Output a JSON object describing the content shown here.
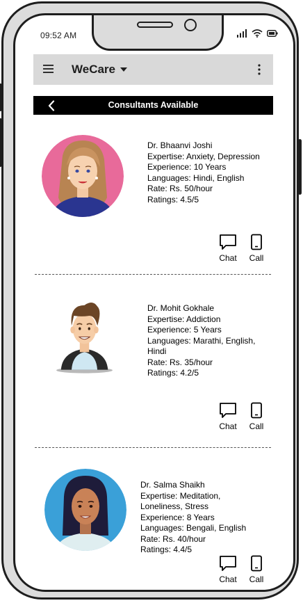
{
  "status_bar": {
    "time": "09:52 AM",
    "icons": [
      "signal-icon",
      "wifi-icon",
      "battery-icon"
    ]
  },
  "app_bar": {
    "title": "WeCare",
    "menu_icon": "hamburger-menu-icon",
    "dropdown_icon": "caret-down-icon",
    "overflow_icon": "more-vertical-icon",
    "background_color": "#d9d9d9"
  },
  "subheader": {
    "title": "Consultants Available",
    "back_icon": "chevron-left-icon",
    "background_color": "#000000"
  },
  "consultants": [
    {
      "name": "Dr. Bhaanvi Joshi",
      "expertise": [
        "Expertise: Anxiety, Depression"
      ],
      "experience": "Experience: 10 Years",
      "languages": [
        "Languages: Hindi, English"
      ],
      "rate": "Rate: Rs. 50/hour",
      "ratings": "Ratings: 4.5/5",
      "avatar_bg": "#e86a9a",
      "chat_label": "Chat",
      "call_label": "Call"
    },
    {
      "name": "Dr. Mohit Gokhale",
      "expertise": [
        "Expertise: Addiction"
      ],
      "experience": "Experience: 5 Years",
      "languages": [
        "Languages: Marathi, English,",
        "Hindi"
      ],
      "rate": "Rate: Rs. 35/hour",
      "ratings": "Ratings: 4.2/5",
      "avatar_bg": "#ffffff",
      "chat_label": "Chat",
      "call_label": "Call"
    },
    {
      "name": "Dr. Salma Shaikh",
      "expertise": [
        "Expertise: Meditation,",
        "Loneliness, Stress"
      ],
      "experience": "Experience: 8 Years",
      "languages": [
        "Languages: Bengali, English"
      ],
      "rate": "Rate: Rs. 40/hour",
      "ratings": "Ratings: 4.4/5",
      "avatar_bg": "#3aa0d8",
      "chat_label": "Chat",
      "call_label": "Call"
    }
  ]
}
